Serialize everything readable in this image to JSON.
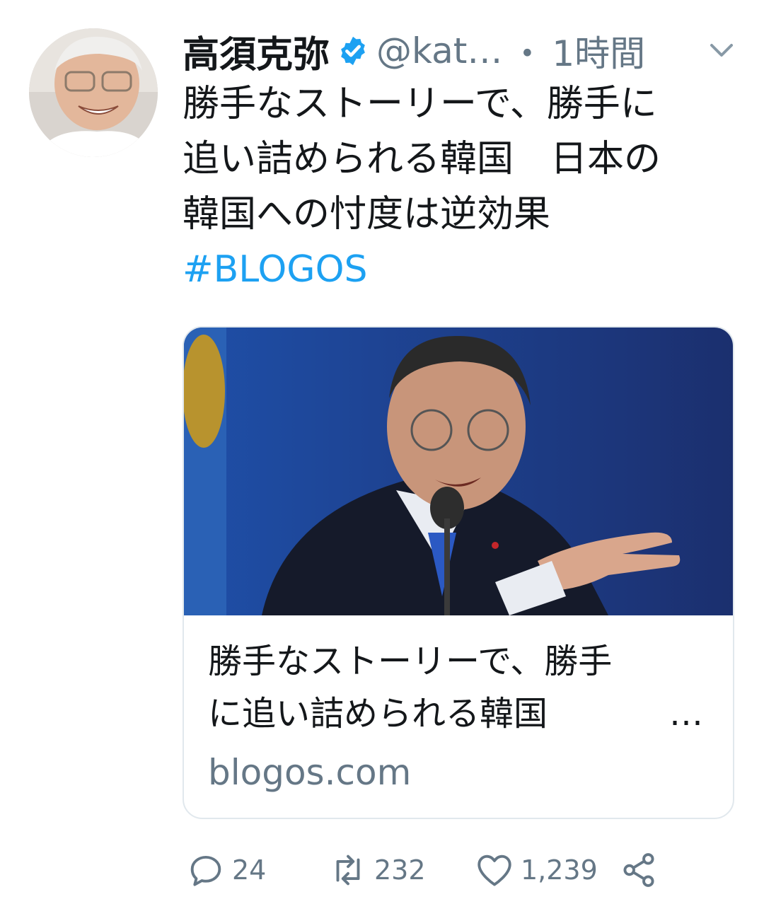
{
  "tweet": {
    "author_name": "高須克弥",
    "handle": "@kat…",
    "separator": "・",
    "time": "1時間",
    "text_lines": [
      "勝手なストーリーで、勝手に",
      "追い詰められる韓国　日本の",
      "韓国への忖度は逆効果"
    ],
    "hashtag": "#BLOGOS"
  },
  "card": {
    "title_lines": [
      "勝手なストーリーで、勝手",
      "に追い詰められる韓国　"
    ],
    "ellipsis": "…",
    "domain": "blogos.com"
  },
  "actions": {
    "replies": "24",
    "retweets": "232",
    "likes": "1,239"
  },
  "icons": {
    "verified": "verified-badge-icon",
    "menu": "chevron-down-icon",
    "reply": "reply-icon",
    "retweet": "retweet-icon",
    "like": "heart-icon",
    "share": "share-icon"
  },
  "colors": {
    "accent": "#1da1f2",
    "secondary_text": "#657786",
    "border": "#e1e8ed"
  }
}
